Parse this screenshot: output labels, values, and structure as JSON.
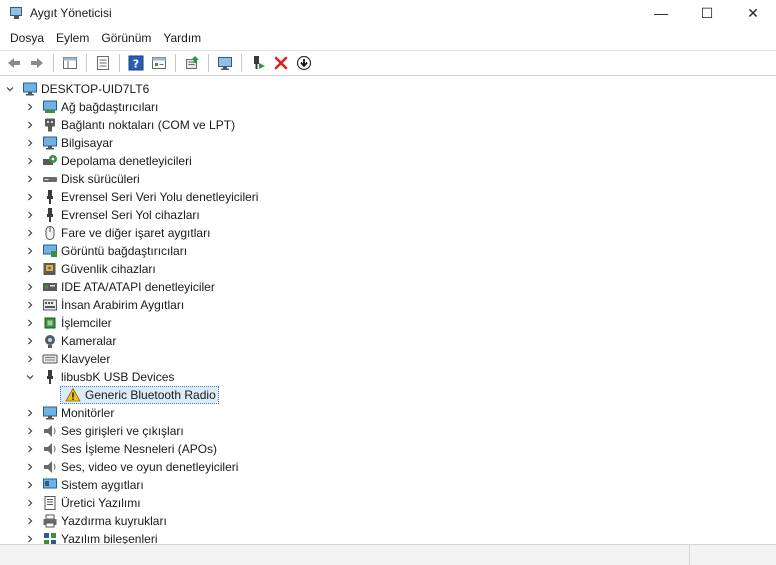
{
  "window": {
    "title": "Aygıt Yöneticisi",
    "minimize_glyph": "—",
    "maximize_glyph": "☐",
    "close_glyph": "✕"
  },
  "menu": [
    "Dosya",
    "Eylem",
    "Görünüm",
    "Yardım"
  ],
  "toolbar": {
    "buttons": [
      "back-icon",
      "forward-icon",
      "properties-grid-icon",
      "list-view-icon",
      "help-icon",
      "details-view-icon",
      "update-driver-icon",
      "scan-hardware-icon",
      "enable-device-icon",
      "uninstall-icon",
      "disable-device-icon"
    ]
  },
  "tree": {
    "root": "DESKTOP-UID7LT6",
    "categories": [
      {
        "label": "Ağ bağdaştırıcıları",
        "icon": "network-adapter-icon",
        "expanded": false
      },
      {
        "label": "Bağlantı noktaları (COM ve LPT)",
        "icon": "port-icon",
        "expanded": false
      },
      {
        "label": "Bilgisayar",
        "icon": "computer-icon",
        "expanded": false
      },
      {
        "label": "Depolama denetleyicileri",
        "icon": "storage-controller-icon",
        "expanded": false
      },
      {
        "label": "Disk sürücüleri",
        "icon": "disk-drive-icon",
        "expanded": false
      },
      {
        "label": "Evrensel Seri Veri Yolu denetleyicileri",
        "icon": "usb-controller-icon",
        "expanded": false
      },
      {
        "label": "Evrensel Seri Yol cihazları",
        "icon": "usb-device-icon",
        "expanded": false
      },
      {
        "label": "Fare ve diğer işaret aygıtları",
        "icon": "mouse-icon",
        "expanded": false
      },
      {
        "label": "Görüntü bağdaştırıcıları",
        "icon": "display-adapter-icon",
        "expanded": false
      },
      {
        "label": "Güvenlik cihazları",
        "icon": "security-device-icon",
        "expanded": false
      },
      {
        "label": "IDE ATA/ATAPI denetleyiciler",
        "icon": "ide-controller-icon",
        "expanded": false
      },
      {
        "label": "İnsan Arabirim Aygıtları",
        "icon": "hid-icon",
        "expanded": false
      },
      {
        "label": "İşlemciler",
        "icon": "processor-icon",
        "expanded": false
      },
      {
        "label": "Kameralar",
        "icon": "camera-icon",
        "expanded": false
      },
      {
        "label": "Klavyeler",
        "icon": "keyboard-icon",
        "expanded": false
      },
      {
        "label": "libusbK USB Devices",
        "icon": "usb-device-icon",
        "expanded": true,
        "children": [
          {
            "label": "Generic Bluetooth Radio",
            "icon": "warning-icon",
            "selected": true
          }
        ]
      },
      {
        "label": "Monitörler",
        "icon": "monitor-icon",
        "expanded": false
      },
      {
        "label": "Ses girişleri ve çıkışları",
        "icon": "speaker-icon",
        "expanded": false
      },
      {
        "label": "Ses İşleme Nesneleri (APOs)",
        "icon": "speaker-icon",
        "expanded": false
      },
      {
        "label": "Ses, video ve oyun denetleyicileri",
        "icon": "speaker-icon",
        "expanded": false
      },
      {
        "label": "Sistem aygıtları",
        "icon": "system-device-icon",
        "expanded": false
      },
      {
        "label": "Üretici Yazılımı",
        "icon": "firmware-icon",
        "expanded": false
      },
      {
        "label": "Yazdırma kuyrukları",
        "icon": "printer-icon",
        "expanded": false
      },
      {
        "label": "Yazılım bileşenleri",
        "icon": "software-component-icon",
        "expanded": false
      }
    ]
  },
  "colors": {
    "selection_bg": "#dcebf8",
    "selection_border": "#3b7fc4",
    "uninstall_red": "#d9241e",
    "warning_yellow": "#f4c21b"
  }
}
